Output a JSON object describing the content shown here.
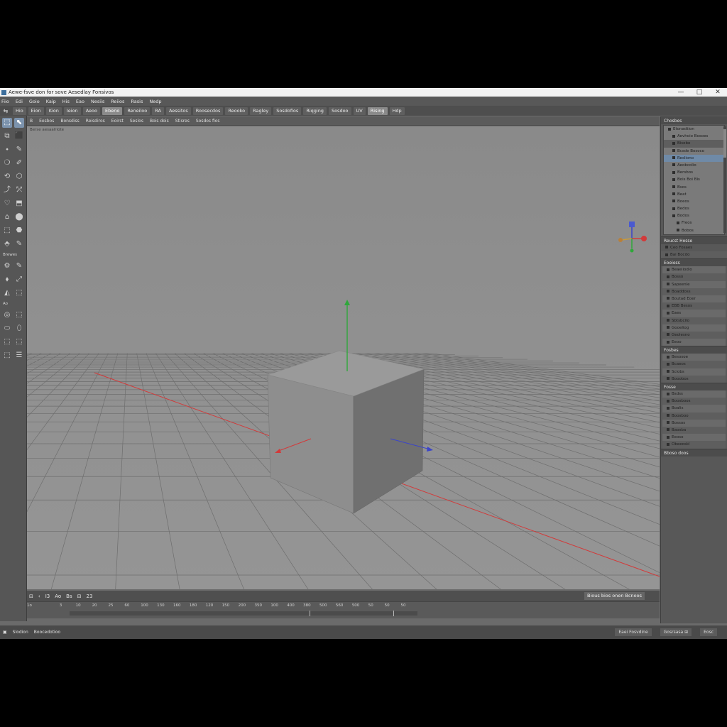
{
  "window": {
    "title": "Aewe-fsve don for sove Aesedlay Fonsivos",
    "controls": [
      "—",
      "□",
      "✕"
    ]
  },
  "menu": [
    "Fiio",
    "Edi",
    "Goio",
    "Kaip",
    "His",
    "Eao",
    "Nesiis",
    "Reiios",
    "Rasis",
    "Nedp"
  ],
  "shelf": {
    "lead_icon": "⇆",
    "tabs": [
      {
        "label": "Hio",
        "active": false
      },
      {
        "label": "Eion",
        "active": false
      },
      {
        "label": "Kion",
        "active": false
      },
      {
        "label": "Ieion",
        "active": false
      },
      {
        "label": "Aeoo",
        "active": false
      },
      {
        "label": "Ebeno",
        "active": true
      },
      {
        "label": "Reneiloo",
        "active": false
      },
      {
        "label": "RA",
        "active": false
      },
      {
        "label": "Aessitos",
        "active": false
      },
      {
        "label": "Roosecdos",
        "active": false
      },
      {
        "label": "Reooko",
        "active": false
      },
      {
        "label": "Ragley",
        "active": false
      },
      {
        "label": "Sosdofios",
        "active": false
      },
      {
        "label": "Riqging",
        "active": false
      },
      {
        "label": "Sosdoo",
        "active": false
      },
      {
        "label": "UV",
        "active": false
      },
      {
        "label": "Rising",
        "active": true
      },
      {
        "label": "Hdp",
        "active": false
      }
    ]
  },
  "viewport_menu": [
    "B",
    "Eesbos",
    "Bonsdiss",
    "Reisdiros",
    "Eoirst",
    "Seslos",
    "Bois dois",
    "Stisres",
    "Sosdos fios"
  ],
  "viewport": {
    "panel_label": "Berse aesaalriote"
  },
  "toolbox": {
    "rows_top": [
      [
        "⬚",
        "⬉"
      ],
      [
        "⧉",
        "⬛"
      ],
      [
        "⬩",
        "✎"
      ],
      [
        "❍",
        "✐"
      ],
      [
        "⟲",
        "⬡"
      ],
      [
        "⤴",
        "⤱"
      ],
      [
        "♡",
        "⬒"
      ],
      [
        "⌂",
        "⬤"
      ],
      [
        "⬚",
        "⬣"
      ],
      [
        "⬘",
        "✎"
      ]
    ],
    "label_1": "Brewes",
    "rows_mid": [
      [
        "⚙",
        "✎"
      ],
      [
        "⬧",
        "⤢"
      ],
      [
        "◭",
        "⬚"
      ]
    ],
    "label_2": "Ao",
    "rows_bot": [
      [
        "◎",
        "⬚"
      ],
      [
        "⬭",
        "⬯"
      ],
      [
        "⬚",
        "⬚"
      ],
      [
        "⬚",
        "☰"
      ]
    ]
  },
  "timeline": {
    "controls": [
      "⊟",
      "‹",
      "I3",
      "Ao",
      "Bs",
      "⊟",
      "23"
    ],
    "range_info": "Bious bios onen Bcnoos",
    "ticks": [
      "1o",
      "",
      "3",
      "10",
      "20",
      "25",
      "60",
      "100",
      "130",
      "160",
      "180",
      "120",
      "150",
      "200",
      "350",
      "100",
      "400",
      "380",
      "500",
      "560",
      "500",
      "50",
      "50",
      "50",
      "",
      "",
      "",
      "",
      "",
      "",
      "",
      "",
      "",
      "",
      "",
      "",
      "",
      "",
      ""
    ],
    "track_marker_frames": [
      0.69,
      0.93
    ]
  },
  "status": {
    "left": [
      "Slodion",
      "Boocedotioo"
    ],
    "right": [
      "Eaei Fosvdine",
      "Gosrsasa ⊞",
      "Eosc"
    ]
  },
  "outliner": {
    "title": "Chosbes",
    "items": [
      {
        "label": "Etonadtion",
        "indent": 0,
        "selected": false
      },
      {
        "label": "Aevhoio Bosoes",
        "indent": 1,
        "selected": false
      },
      {
        "label": "Bisobe",
        "indent": 1,
        "selected": false,
        "alt": true
      },
      {
        "label": "Bcsde Bosoco",
        "indent": 1,
        "selected": false
      },
      {
        "label": "Resliono",
        "indent": 1,
        "selected": true
      },
      {
        "label": "Aeobcolio",
        "indent": 1,
        "selected": false
      },
      {
        "label": "Bersbos",
        "indent": 1,
        "selected": false
      },
      {
        "label": "Bois Boi Bis",
        "indent": 1,
        "selected": false
      },
      {
        "label": "Bsos",
        "indent": 1,
        "selected": false
      },
      {
        "label": "Beat",
        "indent": 1,
        "selected": false
      },
      {
        "label": "Boeos",
        "indent": 1,
        "selected": false
      },
      {
        "label": "Bedos",
        "indent": 1,
        "selected": false
      },
      {
        "label": "Bodos",
        "indent": 1,
        "selected": false
      },
      {
        "label": "Freos",
        "indent": 2,
        "selected": false
      },
      {
        "label": "Bobos",
        "indent": 2,
        "selected": false
      }
    ]
  },
  "attributes": {
    "title": "Reucst Hosse",
    "top_rows": [
      "Ceo Fosaes",
      "Bai Bocdo"
    ],
    "sub_title": "Eoeiess",
    "rows": [
      "Beaeiiodio",
      "Bosso",
      "Sapeenle",
      "Boaddoss",
      "Boutad Eoer",
      "EBB Besos",
      "Eaes",
      "Sbtsbcilo",
      "Gooeliog",
      "Geolesno",
      "Eeoo"
    ]
  },
  "channel_box": {
    "title": "Fosbes",
    "rows": [
      "Besosoe",
      "Bcaeos",
      "Sciobs",
      "Booobos"
    ]
  },
  "layers": {
    "title": "Fosse",
    "rows": [
      "Bsdss",
      "Boosboos",
      "Boalis",
      "Boosboo",
      "Bossos",
      "Baosba",
      "Eeoso",
      "Obeeoskl"
    ],
    "footer": "Bboso doos"
  },
  "colors": {
    "x_axis": "#d23a3a",
    "y_axis": "#2ea83a",
    "z_axis": "#3b45c8",
    "selection": "#6f8aa7"
  }
}
